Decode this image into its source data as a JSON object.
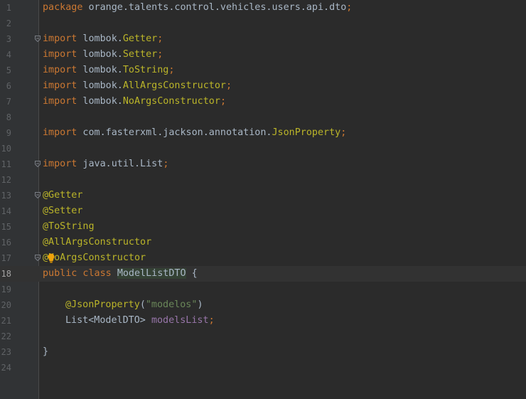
{
  "editor": {
    "lines": [
      {
        "no": "1",
        "parts": [
          {
            "t": "package",
            "c": "kw"
          },
          {
            "t": " orange.talents.control.vehicles.users.api.dto"
          },
          {
            "t": ";",
            "c": "kw"
          }
        ]
      },
      {
        "no": "2",
        "parts": []
      },
      {
        "no": "3",
        "parts": [
          {
            "t": "import",
            "c": "kw"
          },
          {
            "t": " lombok."
          },
          {
            "t": "Getter",
            "c": "ann"
          },
          {
            "t": ";",
            "c": "kw"
          }
        ],
        "fold": true
      },
      {
        "no": "4",
        "parts": [
          {
            "t": "import",
            "c": "kw"
          },
          {
            "t": " lombok."
          },
          {
            "t": "Setter",
            "c": "ann"
          },
          {
            "t": ";",
            "c": "kw"
          }
        ]
      },
      {
        "no": "5",
        "parts": [
          {
            "t": "import",
            "c": "kw"
          },
          {
            "t": " lombok."
          },
          {
            "t": "ToString",
            "c": "ann"
          },
          {
            "t": ";",
            "c": "kw"
          }
        ]
      },
      {
        "no": "6",
        "parts": [
          {
            "t": "import",
            "c": "kw"
          },
          {
            "t": " lombok."
          },
          {
            "t": "AllArgsConstructor",
            "c": "ann"
          },
          {
            "t": ";",
            "c": "kw"
          }
        ]
      },
      {
        "no": "7",
        "parts": [
          {
            "t": "import",
            "c": "kw"
          },
          {
            "t": " lombok."
          },
          {
            "t": "NoArgsConstructor",
            "c": "ann"
          },
          {
            "t": ";",
            "c": "kw"
          }
        ]
      },
      {
        "no": "8",
        "parts": []
      },
      {
        "no": "9",
        "parts": [
          {
            "t": "import",
            "c": "kw"
          },
          {
            "t": " com.fasterxml.jackson.annotation."
          },
          {
            "t": "JsonProperty",
            "c": "ann"
          },
          {
            "t": ";",
            "c": "kw"
          }
        ]
      },
      {
        "no": "10",
        "parts": []
      },
      {
        "no": "11",
        "parts": [
          {
            "t": "import",
            "c": "kw"
          },
          {
            "t": " java.util.List"
          },
          {
            "t": ";",
            "c": "kw"
          }
        ],
        "fold": true
      },
      {
        "no": "12",
        "parts": []
      },
      {
        "no": "13",
        "parts": [
          {
            "t": "@Getter",
            "c": "ann"
          }
        ],
        "fold": true
      },
      {
        "no": "14",
        "parts": [
          {
            "t": "@Setter",
            "c": "ann"
          }
        ]
      },
      {
        "no": "15",
        "parts": [
          {
            "t": "@ToString",
            "c": "ann"
          }
        ]
      },
      {
        "no": "16",
        "parts": [
          {
            "t": "@AllArgsConstructor",
            "c": "ann"
          }
        ]
      },
      {
        "no": "17",
        "parts": [
          {
            "t": "@NoArgsConstructor",
            "c": "ann"
          }
        ],
        "fold": true,
        "bulb": true
      },
      {
        "no": "18",
        "parts": [
          {
            "t": "public class ",
            "c": "kw"
          },
          {
            "t": "ModelListDTO",
            "c": "cls-hl"
          },
          {
            "t": " {"
          }
        ],
        "current": true
      },
      {
        "no": "19",
        "parts": []
      },
      {
        "no": "20",
        "parts": [
          {
            "t": "@JsonProperty",
            "c": "ann"
          },
          {
            "t": "("
          },
          {
            "t": "\"modelos\"",
            "c": "str"
          },
          {
            "t": ")"
          }
        ],
        "indent": true
      },
      {
        "no": "21",
        "parts": [
          {
            "t": "List<ModelDTO> "
          },
          {
            "t": "modelsList",
            "c": "fld"
          },
          {
            "t": ";",
            "c": "kw"
          }
        ],
        "indent": true
      },
      {
        "no": "22",
        "parts": []
      },
      {
        "no": "23",
        "parts": [
          {
            "t": "}"
          }
        ]
      },
      {
        "no": "24",
        "parts": []
      }
    ]
  }
}
